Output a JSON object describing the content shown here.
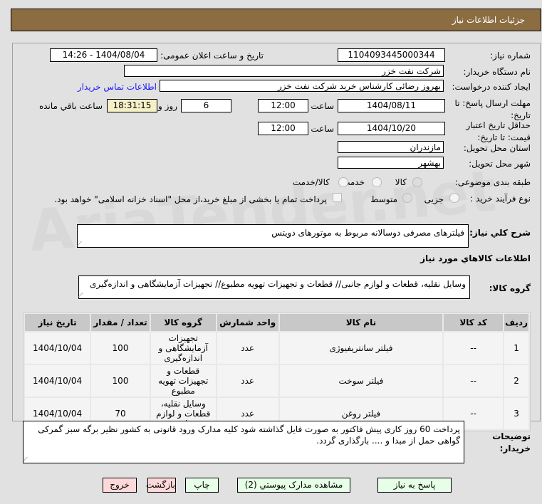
{
  "header": {
    "title": "جزئیات اطلاعات نیاز"
  },
  "form": {
    "need_number_label": "شماره نیاز:",
    "need_number": "1104093445000344",
    "announce_label": "تاریخ و ساعت اعلان عمومی:",
    "announce_value": "1404/08/04 - 14:26",
    "buyer_org_label": "نام دستگاه خریدار:",
    "buyer_org": "شرکت نفت خزر",
    "creator_label": "ایجاد کننده درخواست:",
    "creator": "بهروز رضائی کارشناس خرید شرکت نفت خزر",
    "contact_link": "اطلاعات تماس خریدار",
    "deadline_label": "مهلت ارسال پاسخ: تا تاریخ:",
    "deadline_date": "1404/08/11",
    "time_label": "ساعت",
    "deadline_time": "12:00",
    "days": "6",
    "days_label": "روز و",
    "remaining": "18:31:15",
    "remaining_label": "ساعت باقي مانده",
    "validity_label": "حداقل تاریخ اعتبار قیمت: تا تاریخ:",
    "validity_date": "1404/10/20",
    "validity_time": "12:00",
    "province_label": "استان محل تحویل:",
    "province": "مازندران",
    "city_label": "شهر محل تحویل:",
    "city": "بهشهر",
    "category_label": "طبقه بندی موضوعی:",
    "category_options": [
      "کالا",
      "خدمت",
      "کالا/خدمت"
    ],
    "process_label": "نوع فرآیند خرید :",
    "process_options": [
      "جزیی",
      "متوسط"
    ],
    "payment_note": "پرداخت تمام یا بخشی از مبلغ خرید،از محل \"اسناد خزانه اسلامی\" خواهد بود.",
    "description_label": "شرح کلي نیاز:",
    "description": "فیلترهای مصرفی دوسالانه مربوط به موتورهای دویتس",
    "goods_info_title": "اطلاعات کالاهاي مورد نیاز",
    "group_label": "گروه کالا:",
    "group_value": "وسایل نقلیه، قطعات و لوازم جانبی//  قطعات و تجهیزات تهویه مطبوع// تجهیزات آزمایشگاهی و اندازه‌گیری",
    "notes_label": "توضیحات خریدار:",
    "notes": "پرداخت 60 روز کاری پیش فاکتور به صورت فایل گذاشته شود کلیه مدارک ورود قانونی به کشور نظیر برگه سبز گمرکی گواهی حمل از مبدا و .... بارگذاری گردد."
  },
  "table": {
    "headers": [
      "ردیف",
      "کد کالا",
      "نام کالا",
      "واحد شمارش",
      "گروه کالا",
      "تعداد / مقدار",
      "تاریخ نیاز"
    ],
    "rows": [
      [
        "1",
        "--",
        "فیلتر سانتریفیوژی",
        "عدد",
        "تجهیزات آزمایشگاهی و اندازه‌گیری",
        "100",
        "1404/10/04"
      ],
      [
        "2",
        "--",
        "فیلتر سوخت",
        "عدد",
        "قطعات و تجهیزات تهویه مطبوع",
        "100",
        "1404/10/04"
      ],
      [
        "3",
        "--",
        "فیلتر روغن",
        "عدد",
        "وسایل نقلیه، قطعات و لوازم جانبی",
        "70",
        "1404/10/04"
      ]
    ]
  },
  "buttons": {
    "reply": "پاسخ به نیاز",
    "attachments": "مشاهده مدارک پیوستي (2)",
    "print": "چاپ",
    "back": "بازگشت",
    "exit": "خروج"
  },
  "watermark": "AriaTender.net"
}
